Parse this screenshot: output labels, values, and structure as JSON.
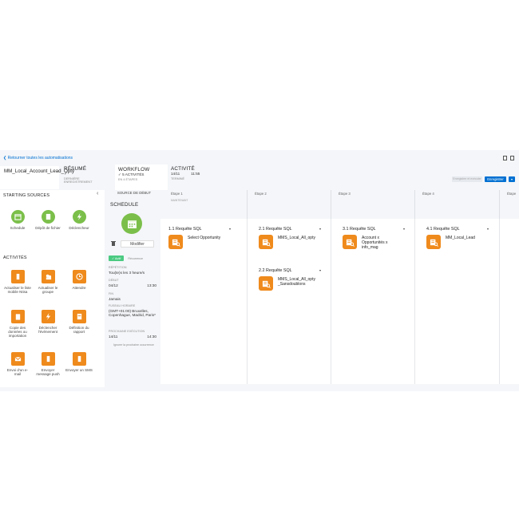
{
  "nav": {
    "back_link": "❮ Retourner toutes les automatisations"
  },
  "automation": {
    "name": "MM_Local_Account_Lead_Opty"
  },
  "tabs": {
    "resume": {
      "title": "RÉSUMÉ",
      "check": "✓",
      "sub": "DERNIÈRE ENREGISTREMENT"
    },
    "workflow": {
      "title": "WORKFLOW",
      "sub": "✓ 5 ACTIVITÉS",
      "sub2": "EN 4 ÉTAPES"
    },
    "activite": {
      "title": "ACTIVITÉ",
      "date": "14/11",
      "time": "11:55",
      "status": "TERMINÉ"
    }
  },
  "header_buttons": {
    "disabled": "Enregistrer et exécuter",
    "save": "Enregistrer",
    "dropdown": "▾"
  },
  "left": {
    "starting_sources_title": "STARTING SOURCES",
    "collapse": "‹",
    "sources": [
      {
        "label": "Schedule",
        "icon": "calendar-icon"
      },
      {
        "label": "Dépôt de fichier",
        "icon": "file-drop-icon"
      },
      {
        "label": "Déclencheur",
        "icon": "lightning-icon"
      }
    ],
    "activites_title": "ACTIVITÉS",
    "activities": [
      {
        "label": "Actualiser le liste mobile Ntisa",
        "icon": "mobile-list-icon"
      },
      {
        "label": "Actualiser le groupe",
        "icon": "group-icon"
      },
      {
        "label": "Attendre",
        "icon": "clock-icon"
      },
      {
        "label": "Copie des données ou importation",
        "icon": "clipboard-icon"
      },
      {
        "label": "Déclencher l'événement",
        "icon": "lightning-icon"
      },
      {
        "label": "Définition du rapport",
        "icon": "report-icon"
      },
      {
        "label": "Envoi d'un e-mail",
        "icon": "email-icon"
      },
      {
        "label": "Envoyer message push",
        "icon": "phone-push-icon"
      },
      {
        "label": "Envoyer un SMS",
        "icon": "sms-icon"
      }
    ]
  },
  "middle": {
    "header": "SOURCE DE DÉBUT",
    "title": "SCHEDULE",
    "modify": "Modifier",
    "status": "✓ Actif",
    "status_meta": "Récurrence",
    "repetition_k": "RÉPÉTITION",
    "repetition_v": "Tou(te)s les 3 heure/s",
    "debut_k": "DÉBUT",
    "debut_date": "04/12",
    "debut_time": "13:30",
    "fin_k": "FIN",
    "fin_v": "Jamais",
    "tz_k": "FUSEAU HORAIRE",
    "tz_v": "(GMT+01:00) Bruxelles, Copenhague, Madrid, Paris*",
    "next_k": "PROCHAINE EXÉCUTION",
    "next_date": "14/11",
    "next_time": "14:30",
    "ignore_link": "Ignorer la prochaine occurrence"
  },
  "workflow": {
    "steps": [
      {
        "label": "Étape 1",
        "sub": "MAINTENANT",
        "activities": [
          {
            "title": "1.1 Requête SQL",
            "text": "Select Opportunity"
          }
        ]
      },
      {
        "label": "Étape 2",
        "activities": [
          {
            "title": "2.1 Requête SQL",
            "text": "MMS_Local_All_opty"
          },
          {
            "title": "2.2 Requête SQL",
            "text": "MMS_Local_All_opty_Sansdoublons"
          }
        ]
      },
      {
        "label": "Étape 3",
        "activities": [
          {
            "title": "3.1 Requête SQL",
            "text": "Account x Opportunités x info_mag"
          }
        ]
      },
      {
        "label": "Étape 4",
        "activities": [
          {
            "title": "4.1 Requête SQL",
            "text": "MM_Local_Lead"
          }
        ]
      },
      {
        "label": "Étape"
      }
    ],
    "activity_dropdown": "▾"
  },
  "colors": {
    "accent": "#0070d2",
    "orange": "#ef8a1c",
    "green": "#7bbf4a",
    "active_green": "#4bca81"
  }
}
